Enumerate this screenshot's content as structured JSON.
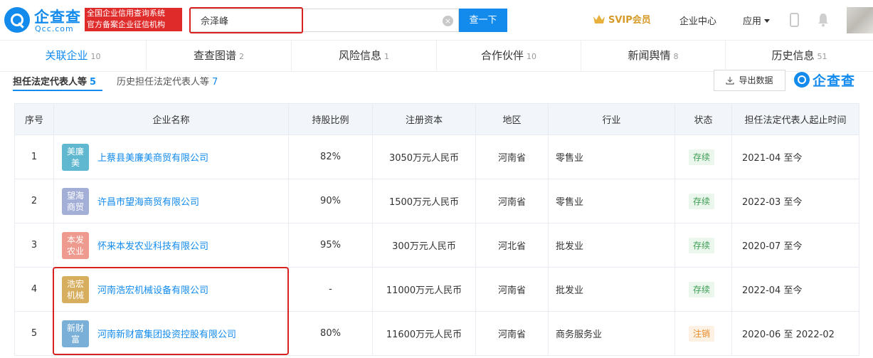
{
  "header": {
    "logo_cn": "企查查",
    "logo_en": "Qcc.com",
    "gov_badge_line1": "全国企业信用查询系统",
    "gov_badge_line2": "官方备案企业征信机构",
    "search_value": "佘泽峰",
    "search_button": "查一下",
    "svip_label": "SVIP会员",
    "enterprise_center": "企业中心",
    "apps_label": "应用"
  },
  "tabs": [
    {
      "label": "关联企业",
      "count": "10"
    },
    {
      "label": "查查图谱",
      "count": "2"
    },
    {
      "label": "风险信息",
      "count": "1"
    },
    {
      "label": "合作伙伴",
      "count": "10"
    },
    {
      "label": "新闻舆情",
      "count": "8"
    },
    {
      "label": "历史信息",
      "count": "51"
    }
  ],
  "subtabs": [
    {
      "label": "担任法定代表人等",
      "count": "5"
    },
    {
      "label": "历史担任法定代表人等",
      "count": "7"
    }
  ],
  "toolbar": {
    "export_label": "导出数据",
    "watermark": "企查查"
  },
  "table": {
    "headers": [
      "序号",
      "企业名称",
      "持股比例",
      "注册资本",
      "地区",
      "行业",
      "状态",
      "担任法定代表人起止时间"
    ],
    "rows": [
      {
        "no": "1",
        "logo": "美廉美",
        "logo_color": "#5fb8cf",
        "name": "上蔡县美廉美商贸有限公司",
        "share": "82%",
        "capital": "3050万元人民币",
        "region": "河南省",
        "industry": "零售业",
        "status": "存续",
        "status_type": "ok",
        "period": "2021-04 至今"
      },
      {
        "no": "2",
        "logo": "望海商贸",
        "logo_color": "#a4afd8",
        "name": "许昌市望海商贸有限公司",
        "share": "90%",
        "capital": "1500万元人民币",
        "region": "河南省",
        "industry": "零售业",
        "status": "存续",
        "status_type": "ok",
        "period": "2022-03 至今"
      },
      {
        "no": "3",
        "logo": "本发农业",
        "logo_color": "#ef9a8e",
        "name": "怀来本发农业科技有限公司",
        "share": "95%",
        "capital": "300万元人民币",
        "region": "河北省",
        "industry": "批发业",
        "status": "存续",
        "status_type": "ok",
        "period": "2020-07 至今"
      },
      {
        "no": "4",
        "logo": "浩宏机械",
        "logo_color": "#d7ad5e",
        "name": "河南浩宏机械设备有限公司",
        "share": "-",
        "capital": "11000万元人民币",
        "region": "河南省",
        "industry": "批发业",
        "status": "存续",
        "status_type": "ok",
        "period": "2022-04 至今"
      },
      {
        "no": "5",
        "logo": "新财富",
        "logo_color": "#7ab0d8",
        "name": "河南新财富集团投资控股有限公司",
        "share": "80%",
        "capital": "11600万元人民币",
        "region": "河南省",
        "industry": "商务服务业",
        "status": "注销",
        "status_type": "warn",
        "period": "2020-06 至 2022-02"
      }
    ]
  },
  "colors": {
    "brand": "#128bed",
    "highlight": "#d72222",
    "status_ok": "#3d9d55",
    "status_warn": "#e98a2a",
    "svip": "#d79a28"
  }
}
